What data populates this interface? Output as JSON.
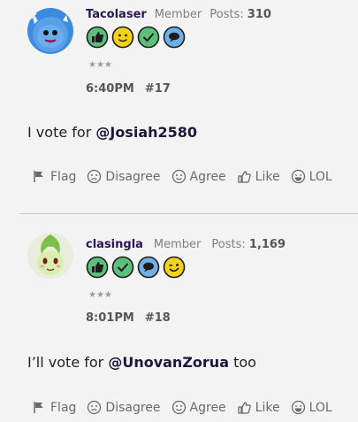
{
  "posts": [
    {
      "username": "Tacolaser",
      "role": "Member",
      "posts_label": "Posts:",
      "posts_count": "310",
      "stars": "★★★",
      "time": "6:40PM",
      "number": "#17",
      "text_prefix": "I vote for ",
      "mention": "@Josiah2580",
      "text_suffix": "",
      "badges": [
        "thumbs-up-icon",
        "smiley-icon",
        "check-icon",
        "speech-bubble-icon"
      ]
    },
    {
      "username": "clasingla",
      "role": "Member",
      "posts_label": "Posts:",
      "posts_count": "1,169",
      "stars": "★★★",
      "time": "8:01PM",
      "number": "#18",
      "text_prefix": "I’ll vote for ",
      "mention": "@UnovanZorua",
      "text_suffix": " too",
      "badges": [
        "thumbs-up-icon",
        "check-icon",
        "speech-bubble-icon",
        "wink-icon"
      ]
    }
  ],
  "reactions": {
    "flag": "Flag",
    "disagree": "Disagree",
    "agree": "Agree",
    "like": "Like",
    "lol": "LOL"
  },
  "colors": {
    "background": "#f3f3f3",
    "username": "#2a1650",
    "badge_green": "#5cc07a",
    "badge_yellow": "#f5d21a",
    "badge_blue": "#6fb0e6"
  }
}
